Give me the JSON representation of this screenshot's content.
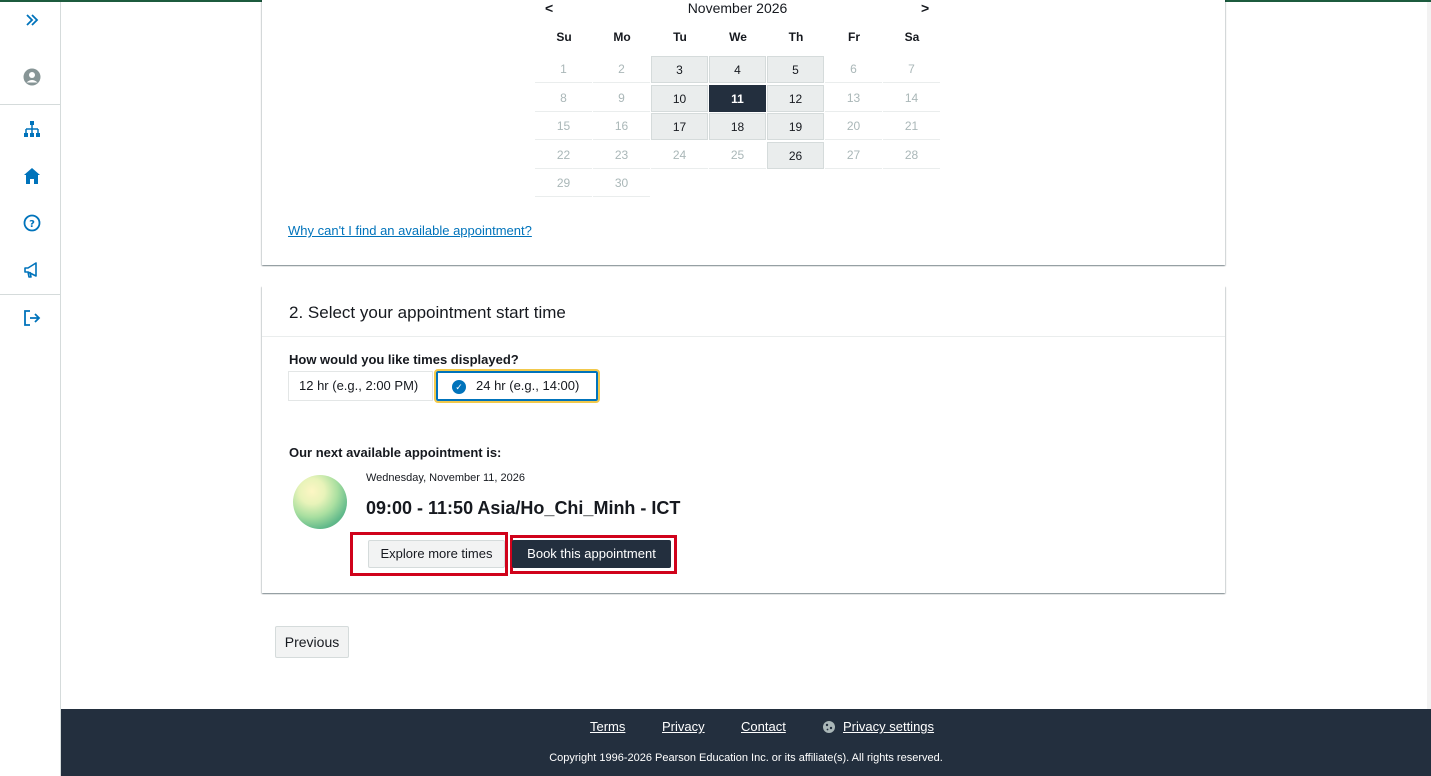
{
  "sidebar": {
    "items": [
      {
        "icon": "expand-chevrons-icon"
      },
      {
        "icon": "user-account-icon"
      },
      {
        "icon": "sitemap-icon"
      },
      {
        "icon": "home-icon"
      },
      {
        "icon": "help-icon"
      },
      {
        "icon": "announcement-megaphone-icon"
      },
      {
        "icon": "sign-out-icon"
      }
    ],
    "icon_color": "#0073bb"
  },
  "calendar": {
    "month_label": "November 2026",
    "prev_label": "<",
    "next_label": ">",
    "days_of_week": [
      "Su",
      "Mo",
      "Tu",
      "We",
      "Th",
      "Fr",
      "Sa"
    ],
    "days": [
      {
        "n": "1",
        "s": "dis"
      },
      {
        "n": "2",
        "s": "dis"
      },
      {
        "n": "3",
        "s": "avail"
      },
      {
        "n": "4",
        "s": "avail"
      },
      {
        "n": "5",
        "s": "avail"
      },
      {
        "n": "6",
        "s": "dis"
      },
      {
        "n": "7",
        "s": "dis"
      },
      {
        "n": "8",
        "s": "dis"
      },
      {
        "n": "9",
        "s": "dis"
      },
      {
        "n": "10",
        "s": "avail"
      },
      {
        "n": "11",
        "s": "sel"
      },
      {
        "n": "12",
        "s": "avail"
      },
      {
        "n": "13",
        "s": "dis"
      },
      {
        "n": "14",
        "s": "dis"
      },
      {
        "n": "15",
        "s": "dis"
      },
      {
        "n": "16",
        "s": "dis"
      },
      {
        "n": "17",
        "s": "avail"
      },
      {
        "n": "18",
        "s": "avail"
      },
      {
        "n": "19",
        "s": "avail"
      },
      {
        "n": "20",
        "s": "dis"
      },
      {
        "n": "21",
        "s": "dis"
      },
      {
        "n": "22",
        "s": "dis"
      },
      {
        "n": "23",
        "s": "dis"
      },
      {
        "n": "24",
        "s": "dis"
      },
      {
        "n": "25",
        "s": "dis"
      },
      {
        "n": "26",
        "s": "avail"
      },
      {
        "n": "27",
        "s": "dis"
      },
      {
        "n": "28",
        "s": "dis"
      },
      {
        "n": "29",
        "s": "dis"
      },
      {
        "n": "30",
        "s": "dis"
      }
    ],
    "help_link": "Why can't I find an available appointment?"
  },
  "time_section": {
    "title": "2. Select your appointment start time",
    "display_question": "How would you like times displayed?",
    "option_12": "12 hr (e.g., 2:00 PM)",
    "option_24": "24 hr (e.g., 14:00)",
    "selected_option": "24 hr",
    "next_available_label": "Our next available appointment is:",
    "appointment_date": "Wednesday, November 11, 2026",
    "appointment_time": "09:00 - 11:50 Asia/Ho_Chi_Minh - ICT",
    "explore_button": "Explore more times",
    "book_button": "Book this appointment"
  },
  "navigation": {
    "previous_button": "Previous"
  },
  "footer": {
    "links": [
      "Terms",
      "Privacy",
      "Contact",
      "Privacy settings"
    ],
    "copyright": "Copyright 1996-2026 Pearson Education Inc. or its affiliate(s). All rights reserved."
  }
}
